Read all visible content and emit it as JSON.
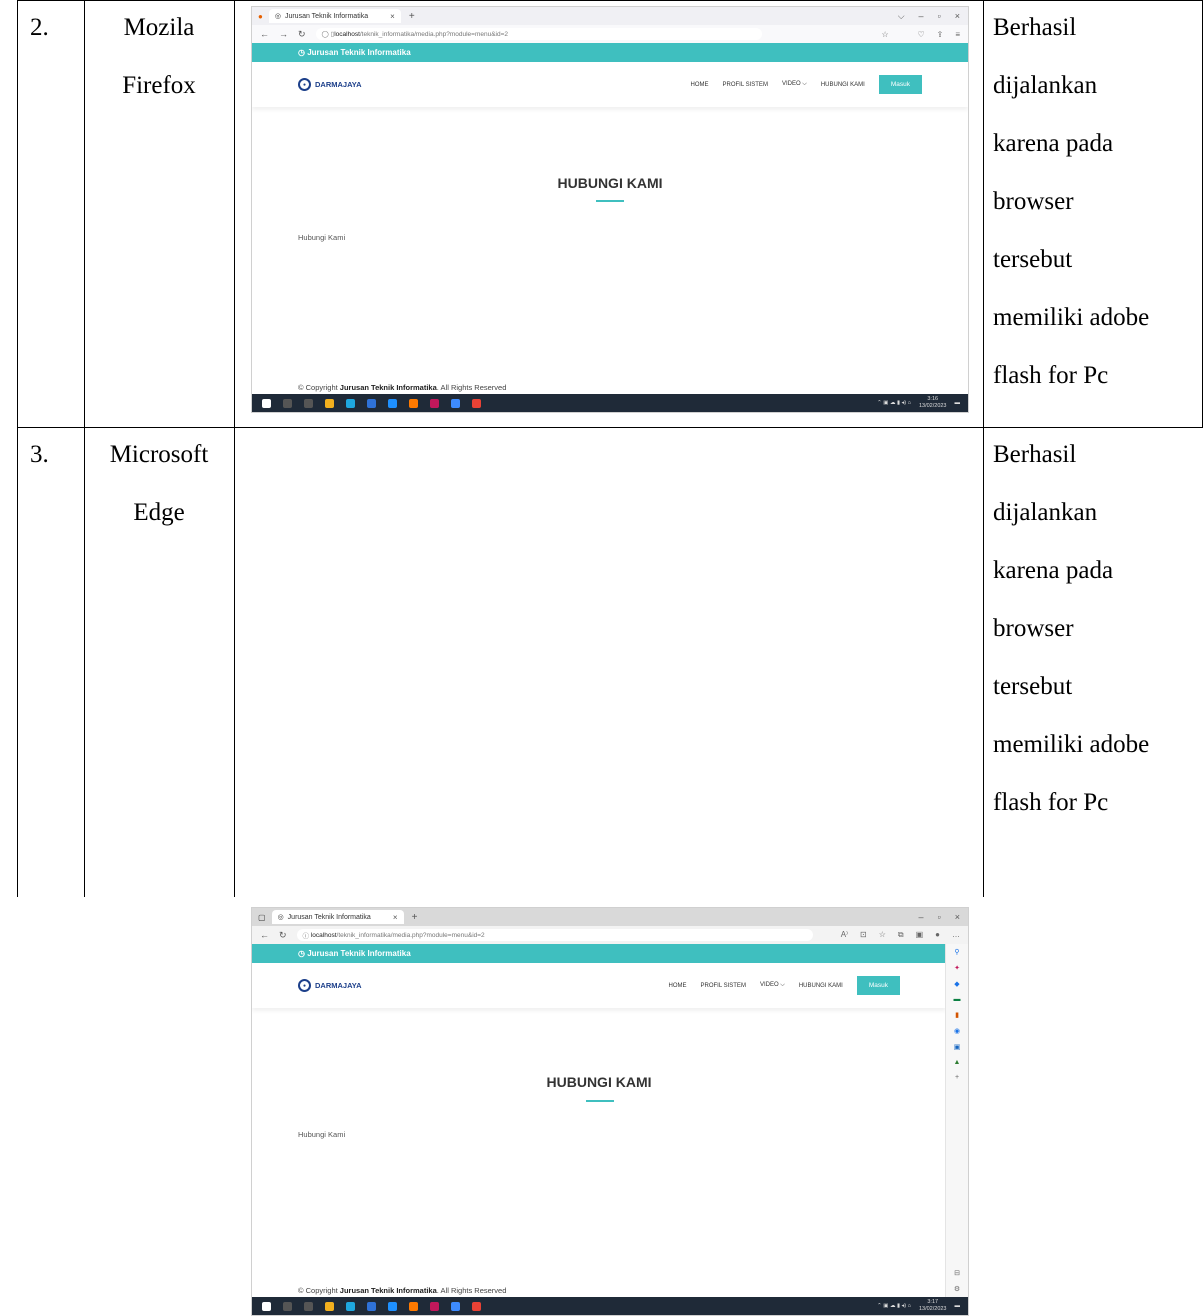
{
  "rows": [
    {
      "number": "2.",
      "browser_lines": [
        "Mozila",
        "Firefox"
      ],
      "result_lines": [
        "Berhasil",
        "dijalankan",
        "karena pada",
        "browser",
        "tersebut",
        "memiliki adobe",
        "flash for Pc"
      ],
      "screenshot": {
        "tab_title": "Jurusan Teknik Informatika",
        "url_host": "localhost",
        "url_path": "/teknik_informatika/media.php?module=menu&id=2",
        "topbar_text": "Jurusan Teknik Informatika",
        "logo_text": "DARMAJAYA",
        "menu": [
          "HOME",
          "PROFIL SISTEM",
          "VIDEO ⌵",
          "HUBUNGI KAMI"
        ],
        "login_button": "Masuk",
        "heading": "HUBUNGI KAMI",
        "body_text": "Hubungi Kami",
        "copyright_prefix": "© Copyright ",
        "copyright_name": "Jurusan Teknik Informatika",
        "copyright_suffix": ". All Rights Reserved",
        "clock_time": "3:16",
        "clock_date": "13/02/2023"
      }
    },
    {
      "number": "3.",
      "browser_lines": [
        "Microsoft",
        "Edge"
      ],
      "result_lines": [
        "Berhasil",
        "dijalankan",
        "karena pada",
        "browser",
        "tersebut",
        "memiliki adobe",
        "flash for Pc"
      ],
      "screenshot": {
        "tab_title": "Jurusan Teknik Informatika",
        "url_host": "localhost",
        "url_path": "/teknik_informatika/media.php?module=menu&id=2",
        "topbar_text": "Jurusan Teknik Informatika",
        "logo_text": "DARMAJAYA",
        "menu": [
          "HOME",
          "PROFIL SISTEM",
          "VIDEO ⌵",
          "HUBUNGI KAMI"
        ],
        "login_button": "Masuk",
        "heading": "HUBUNGI KAMI",
        "body_text": "Hubungi Kami",
        "copyright_prefix": "© Copyright ",
        "copyright_name": "Jurusan Teknik Informatika",
        "copyright_suffix": ". All Rights Reserved",
        "clock_time": "3:17",
        "clock_date": "13/02/2023"
      }
    }
  ],
  "taskbar_icon_colors": [
    "#ffffff",
    "#3a7bd5",
    "#f2b01e",
    "#1fa8e0",
    "#2f72d8",
    "#1e90ff",
    "#ff7a00",
    "#c2185b",
    "#3d8bff",
    "#e94235"
  ]
}
